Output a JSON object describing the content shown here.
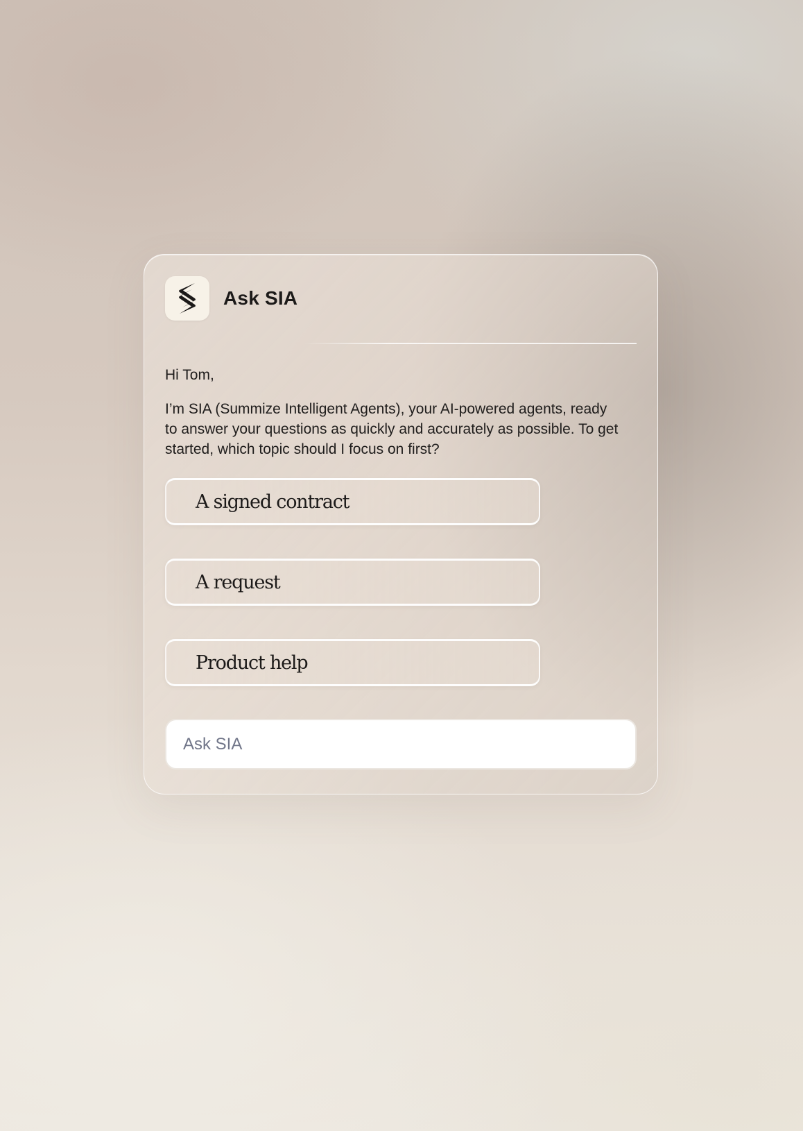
{
  "panel": {
    "logo_icon": "sia-s-logo-icon",
    "title": "Ask SIA"
  },
  "message": {
    "greeting": "Hi Tom,",
    "intro": "I’m SIA (Summize Intelligent Agents), your AI-powered agents, ready to answer your questions as quickly and accurately as possible. To get started, which topic should I focus on first?"
  },
  "options": [
    {
      "label": "A signed contract"
    },
    {
      "label": "A request"
    },
    {
      "label": "Product help"
    }
  ],
  "input": {
    "placeholder": "Ask SIA",
    "value": ""
  },
  "colors": {
    "logo_background": "#f7f2e8",
    "text": "#1c1a19",
    "placeholder": "#717689",
    "input_background": "#ffffff"
  }
}
